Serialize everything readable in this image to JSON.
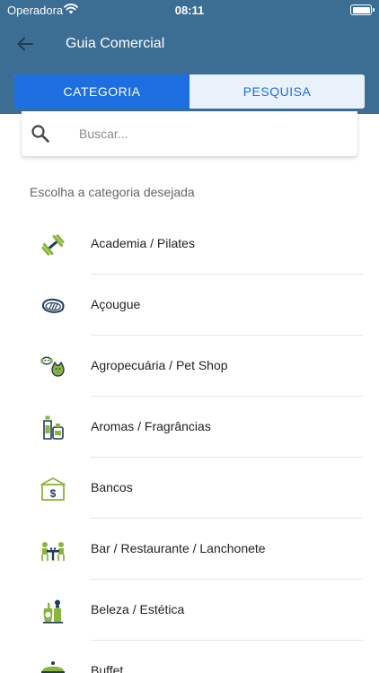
{
  "status_bar": {
    "carrier": "Operadora",
    "time": "08:11"
  },
  "header": {
    "title": "Guia Comercial"
  },
  "tabs": [
    {
      "label": "CATEGORIA",
      "active": true
    },
    {
      "label": "PESQUISA",
      "active": false
    }
  ],
  "search": {
    "placeholder": "Buscar...",
    "value": ""
  },
  "section_label": "Escolha a categoria desejada",
  "categories": [
    {
      "label": "Academia / Pilates",
      "icon": "dumbbell-icon"
    },
    {
      "label": "Açougue",
      "icon": "steak-icon"
    },
    {
      "label": "Agropecuária / Pet Shop",
      "icon": "pets-icon"
    },
    {
      "label": "Aromas / Fragrâncias",
      "icon": "perfume-bottles-icon"
    },
    {
      "label": "Bancos",
      "icon": "bank-icon"
    },
    {
      "label": "Bar / Restaurante / Lanchonete",
      "icon": "restaurant-table-icon"
    },
    {
      "label": "Beleza / Estética",
      "icon": "beauty-products-icon"
    },
    {
      "label": "Buffet",
      "icon": "buffet-icon"
    }
  ],
  "colors": {
    "header": "#3c6d93",
    "accent": "#1d6ee0",
    "tab_inactive_bg": "#e9f2fb",
    "icon_green": "#8bb43c",
    "icon_navy": "#1f3a5a"
  }
}
